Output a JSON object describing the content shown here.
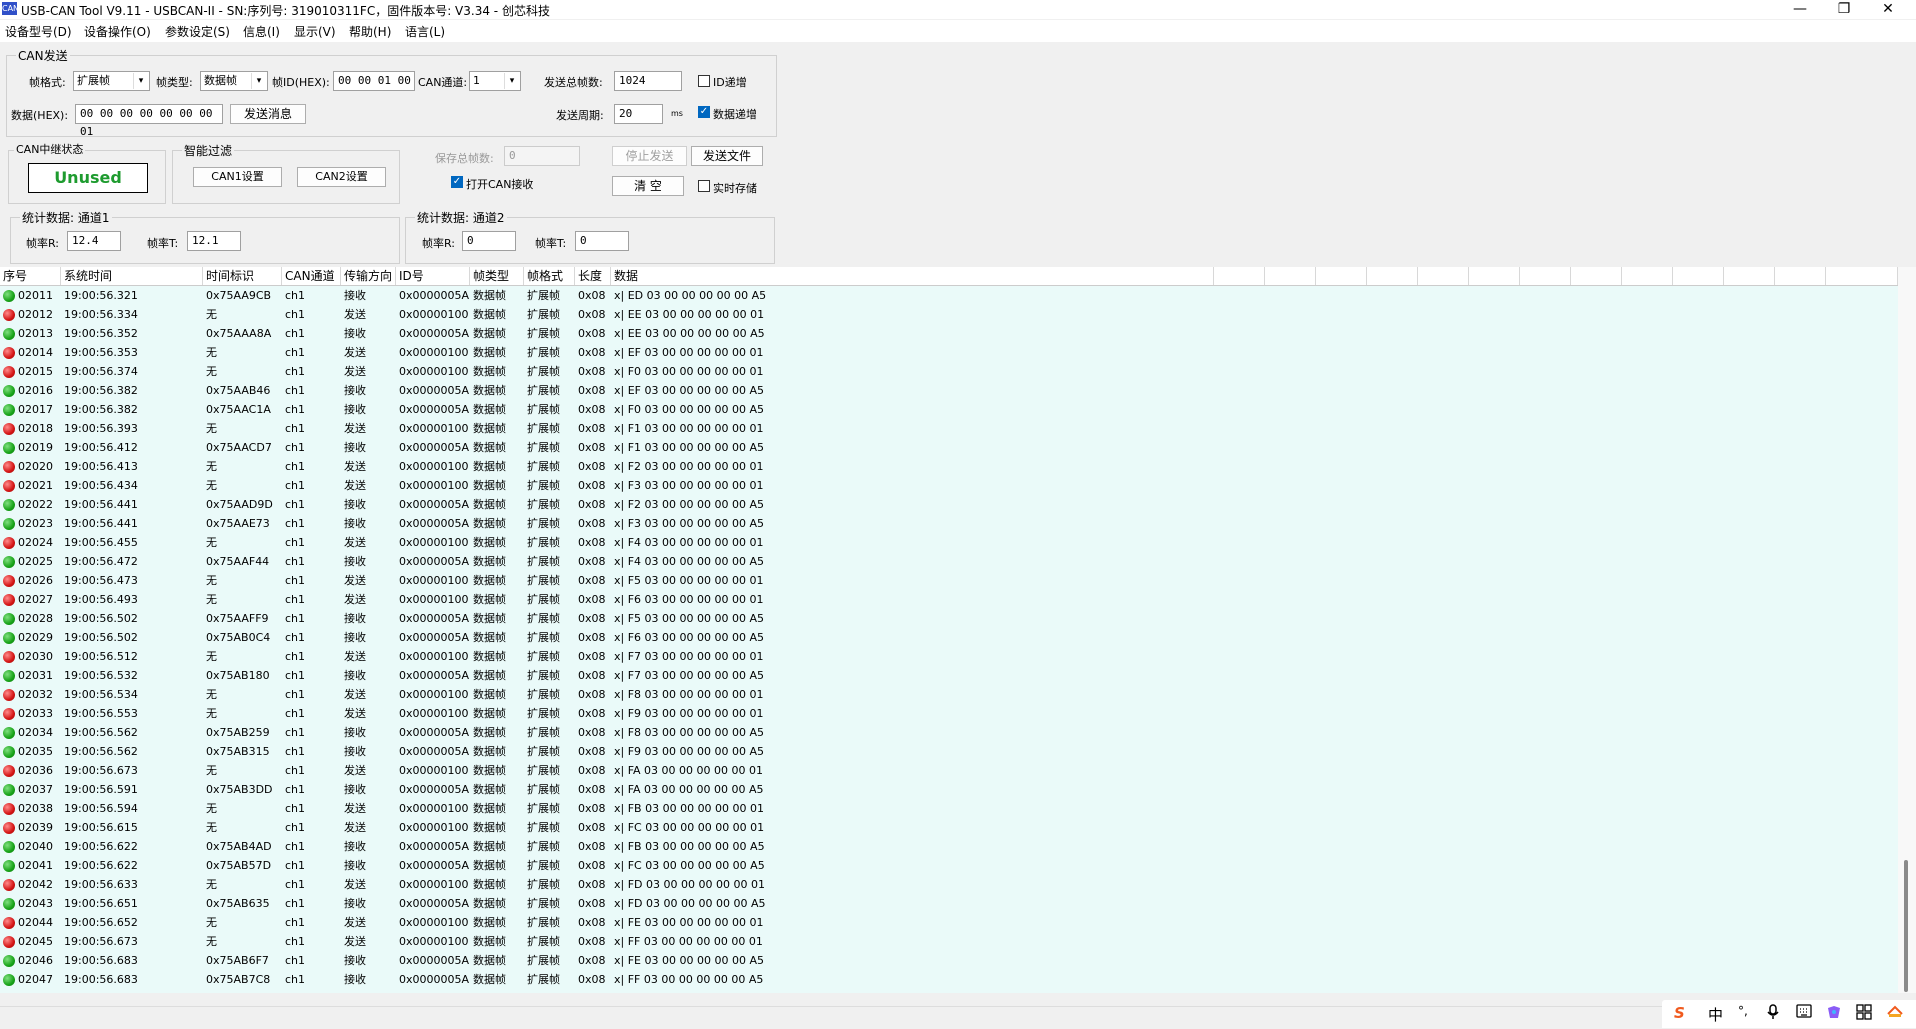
{
  "window": {
    "title": "USB-CAN Tool V9.11 - USBCAN-II - SN:序列号: 319010311FC，固件版本号: V3.34 - 创芯科技",
    "icon_label": "CAN",
    "minimize": "—",
    "maximize": "❐",
    "close": "✕"
  },
  "menu": [
    "设备型号(D)",
    "设备操作(O)",
    "参数设定(S)",
    "信息(I)",
    "显示(V)",
    "帮助(H)",
    "语言(L)"
  ],
  "send": {
    "group_title": "CAN发送",
    "frame_format_label": "帧格式:",
    "frame_format_value": "扩展帧",
    "frame_type_label": "帧类型:",
    "frame_type_value": "数据帧",
    "frame_id_label": "帧ID(HEX):",
    "frame_id_value": "00 00 01 00",
    "channel_label": "CAN通道:",
    "channel_value": "1",
    "total_frames_label": "发送总帧数:",
    "total_frames_value": "1024",
    "id_increment_label": "ID递增",
    "data_label": "数据(HEX):",
    "data_value": "00 00 00 00 00 00 00 01",
    "send_button": "发送消息",
    "period_label": "发送周期:",
    "period_value": "20",
    "period_unit": "ms",
    "data_increment_label": "数据递增"
  },
  "relay": {
    "group_title": "CAN中继状态",
    "status": "Unused"
  },
  "filter": {
    "group_title": "智能过滤",
    "can1_button": "CAN1设置",
    "can2_button": "CAN2设置"
  },
  "save": {
    "total_label": "保存总帧数:",
    "total_value": "0",
    "stop_button": "停止发送",
    "send_file_button": "发送文件",
    "open_can_label": "打开CAN接收",
    "clear_button": "清 空",
    "realtime_label": "实时存储"
  },
  "stats1": {
    "title": "统计数据: 通道1",
    "rate_r_label": "帧率R:",
    "rate_r": "12.4",
    "rate_t_label": "帧率T:",
    "rate_t": "12.1"
  },
  "stats2": {
    "title": "统计数据: 通道2",
    "rate_r_label": "帧率R:",
    "rate_r": "0",
    "rate_t_label": "帧率T:",
    "rate_t": "0"
  },
  "table": {
    "columns": [
      "序号",
      "系统时间",
      "时间标识",
      "CAN通道",
      "传输方向",
      "ID号",
      "帧类型",
      "帧格式",
      "长度",
      "数据"
    ],
    "rows": [
      [
        "02011",
        "19:00:56.321",
        "0x75AA9CB",
        "ch1",
        "接收",
        "0x0000005A",
        "数据帧",
        "扩展帧",
        "0x08",
        "x| ED 03 00 00 00 00 00 A5",
        "green"
      ],
      [
        "02012",
        "19:00:56.334",
        "无",
        "ch1",
        "发送",
        "0x00000100",
        "数据帧",
        "扩展帧",
        "0x08",
        "x| EE 03 00 00 00 00 00 01",
        "red"
      ],
      [
        "02013",
        "19:00:56.352",
        "0x75AAA8A",
        "ch1",
        "接收",
        "0x0000005A",
        "数据帧",
        "扩展帧",
        "0x08",
        "x| EE 03 00 00 00 00 00 A5",
        "green"
      ],
      [
        "02014",
        "19:00:56.353",
        "无",
        "ch1",
        "发送",
        "0x00000100",
        "数据帧",
        "扩展帧",
        "0x08",
        "x| EF 03 00 00 00 00 00 01",
        "red"
      ],
      [
        "02015",
        "19:00:56.374",
        "无",
        "ch1",
        "发送",
        "0x00000100",
        "数据帧",
        "扩展帧",
        "0x08",
        "x| F0 03 00 00 00 00 00 01",
        "red"
      ],
      [
        "02016",
        "19:00:56.382",
        "0x75AAB46",
        "ch1",
        "接收",
        "0x0000005A",
        "数据帧",
        "扩展帧",
        "0x08",
        "x| EF 03 00 00 00 00 00 A5",
        "green"
      ],
      [
        "02017",
        "19:00:56.382",
        "0x75AAC1A",
        "ch1",
        "接收",
        "0x0000005A",
        "数据帧",
        "扩展帧",
        "0x08",
        "x| F0 03 00 00 00 00 00 A5",
        "green"
      ],
      [
        "02018",
        "19:00:56.393",
        "无",
        "ch1",
        "发送",
        "0x00000100",
        "数据帧",
        "扩展帧",
        "0x08",
        "x| F1 03 00 00 00 00 00 01",
        "red"
      ],
      [
        "02019",
        "19:00:56.412",
        "0x75AACD7",
        "ch1",
        "接收",
        "0x0000005A",
        "数据帧",
        "扩展帧",
        "0x08",
        "x| F1 03 00 00 00 00 00 A5",
        "green"
      ],
      [
        "02020",
        "19:00:56.413",
        "无",
        "ch1",
        "发送",
        "0x00000100",
        "数据帧",
        "扩展帧",
        "0x08",
        "x| F2 03 00 00 00 00 00 01",
        "red"
      ],
      [
        "02021",
        "19:00:56.434",
        "无",
        "ch1",
        "发送",
        "0x00000100",
        "数据帧",
        "扩展帧",
        "0x08",
        "x| F3 03 00 00 00 00 00 01",
        "red"
      ],
      [
        "02022",
        "19:00:56.441",
        "0x75AAD9D",
        "ch1",
        "接收",
        "0x0000005A",
        "数据帧",
        "扩展帧",
        "0x08",
        "x| F2 03 00 00 00 00 00 A5",
        "green"
      ],
      [
        "02023",
        "19:00:56.441",
        "0x75AAE73",
        "ch1",
        "接收",
        "0x0000005A",
        "数据帧",
        "扩展帧",
        "0x08",
        "x| F3 03 00 00 00 00 00 A5",
        "green"
      ],
      [
        "02024",
        "19:00:56.455",
        "无",
        "ch1",
        "发送",
        "0x00000100",
        "数据帧",
        "扩展帧",
        "0x08",
        "x| F4 03 00 00 00 00 00 01",
        "red"
      ],
      [
        "02025",
        "19:00:56.472",
        "0x75AAF44",
        "ch1",
        "接收",
        "0x0000005A",
        "数据帧",
        "扩展帧",
        "0x08",
        "x| F4 03 00 00 00 00 00 A5",
        "green"
      ],
      [
        "02026",
        "19:00:56.473",
        "无",
        "ch1",
        "发送",
        "0x00000100",
        "数据帧",
        "扩展帧",
        "0x08",
        "x| F5 03 00 00 00 00 00 01",
        "red"
      ],
      [
        "02027",
        "19:00:56.493",
        "无",
        "ch1",
        "发送",
        "0x00000100",
        "数据帧",
        "扩展帧",
        "0x08",
        "x| F6 03 00 00 00 00 00 01",
        "red"
      ],
      [
        "02028",
        "19:00:56.502",
        "0x75AAFF9",
        "ch1",
        "接收",
        "0x0000005A",
        "数据帧",
        "扩展帧",
        "0x08",
        "x| F5 03 00 00 00 00 00 A5",
        "green"
      ],
      [
        "02029",
        "19:00:56.502",
        "0x75AB0C4",
        "ch1",
        "接收",
        "0x0000005A",
        "数据帧",
        "扩展帧",
        "0x08",
        "x| F6 03 00 00 00 00 00 A5",
        "green"
      ],
      [
        "02030",
        "19:00:56.512",
        "无",
        "ch1",
        "发送",
        "0x00000100",
        "数据帧",
        "扩展帧",
        "0x08",
        "x| F7 03 00 00 00 00 00 01",
        "red"
      ],
      [
        "02031",
        "19:00:56.532",
        "0x75AB180",
        "ch1",
        "接收",
        "0x0000005A",
        "数据帧",
        "扩展帧",
        "0x08",
        "x| F7 03 00 00 00 00 00 A5",
        "green"
      ],
      [
        "02032",
        "19:00:56.534",
        "无",
        "ch1",
        "发送",
        "0x00000100",
        "数据帧",
        "扩展帧",
        "0x08",
        "x| F8 03 00 00 00 00 00 01",
        "red"
      ],
      [
        "02033",
        "19:00:56.553",
        "无",
        "ch1",
        "发送",
        "0x00000100",
        "数据帧",
        "扩展帧",
        "0x08",
        "x| F9 03 00 00 00 00 00 01",
        "red"
      ],
      [
        "02034",
        "19:00:56.562",
        "0x75AB259",
        "ch1",
        "接收",
        "0x0000005A",
        "数据帧",
        "扩展帧",
        "0x08",
        "x| F8 03 00 00 00 00 00 A5",
        "green"
      ],
      [
        "02035",
        "19:00:56.562",
        "0x75AB315",
        "ch1",
        "接收",
        "0x0000005A",
        "数据帧",
        "扩展帧",
        "0x08",
        "x| F9 03 00 00 00 00 00 A5",
        "green"
      ],
      [
        "02036",
        "19:00:56.673",
        "无",
        "ch1",
        "发送",
        "0x00000100",
        "数据帧",
        "扩展帧",
        "0x08",
        "x| FA 03 00 00 00 00 00 01",
        "red"
      ],
      [
        "02037",
        "19:00:56.591",
        "0x75AB3DD",
        "ch1",
        "接收",
        "0x0000005A",
        "数据帧",
        "扩展帧",
        "0x08",
        "x| FA 03 00 00 00 00 00 A5",
        "green"
      ],
      [
        "02038",
        "19:00:56.594",
        "无",
        "ch1",
        "发送",
        "0x00000100",
        "数据帧",
        "扩展帧",
        "0x08",
        "x| FB 03 00 00 00 00 00 01",
        "red"
      ],
      [
        "02039",
        "19:00:56.615",
        "无",
        "ch1",
        "发送",
        "0x00000100",
        "数据帧",
        "扩展帧",
        "0x08",
        "x| FC 03 00 00 00 00 00 01",
        "red"
      ],
      [
        "02040",
        "19:00:56.622",
        "0x75AB4AD",
        "ch1",
        "接收",
        "0x0000005A",
        "数据帧",
        "扩展帧",
        "0x08",
        "x| FB 03 00 00 00 00 00 A5",
        "green"
      ],
      [
        "02041",
        "19:00:56.622",
        "0x75AB57D",
        "ch1",
        "接收",
        "0x0000005A",
        "数据帧",
        "扩展帧",
        "0x08",
        "x| FC 03 00 00 00 00 00 A5",
        "green"
      ],
      [
        "02042",
        "19:00:56.633",
        "无",
        "ch1",
        "发送",
        "0x00000100",
        "数据帧",
        "扩展帧",
        "0x08",
        "x| FD 03 00 00 00 00 00 01",
        "red"
      ],
      [
        "02043",
        "19:00:56.651",
        "0x75AB635",
        "ch1",
        "接收",
        "0x0000005A",
        "数据帧",
        "扩展帧",
        "0x08",
        "x| FD 03 00 00 00 00 00 A5",
        "green"
      ],
      [
        "02044",
        "19:00:56.652",
        "无",
        "ch1",
        "发送",
        "0x00000100",
        "数据帧",
        "扩展帧",
        "0x08",
        "x| FE 03 00 00 00 00 00 01",
        "red"
      ],
      [
        "02045",
        "19:00:56.673",
        "无",
        "ch1",
        "发送",
        "0x00000100",
        "数据帧",
        "扩展帧",
        "0x08",
        "x| FF 03 00 00 00 00 00 01",
        "red"
      ],
      [
        "02046",
        "19:00:56.683",
        "0x75AB6F7",
        "ch1",
        "接收",
        "0x0000005A",
        "数据帧",
        "扩展帧",
        "0x08",
        "x| FE 03 00 00 00 00 00 A5",
        "green"
      ],
      [
        "02047",
        "19:00:56.683",
        "0x75AB7C8",
        "ch1",
        "接收",
        "0x0000005A",
        "数据帧",
        "扩展帧",
        "0x08",
        "x| FF 03 00 00 00 00 00 A5",
        "green"
      ]
    ]
  },
  "ime": {
    "logo": "S",
    "mode": "中",
    "punct": "°,"
  }
}
